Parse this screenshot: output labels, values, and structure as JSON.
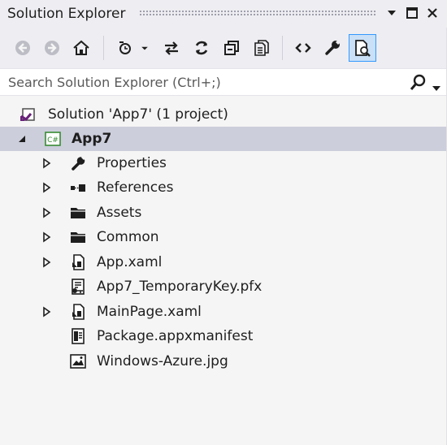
{
  "window": {
    "title": "Solution Explorer"
  },
  "toolbar": {
    "tools": [
      {
        "name": "back-icon"
      },
      {
        "name": "forward-icon"
      },
      {
        "name": "home-icon"
      },
      {
        "name": "pending-changes-filter-icon"
      },
      {
        "name": "sync-with-active-document-icon"
      },
      {
        "name": "refresh-icon"
      },
      {
        "name": "collapse-all-icon"
      },
      {
        "name": "show-all-files-icon"
      },
      {
        "name": "view-code-icon"
      },
      {
        "name": "properties-icon"
      },
      {
        "name": "preview-selected-items-icon"
      }
    ]
  },
  "search": {
    "placeholder": "Search Solution Explorer (Ctrl+;)"
  },
  "tree": {
    "solution": {
      "label": "Solution 'App7' (1 project)"
    },
    "project": {
      "label": "App7",
      "selected": true
    },
    "items": [
      {
        "label": "Properties",
        "icon": "wrench-icon",
        "expandable": true
      },
      {
        "label": "References",
        "icon": "references-icon",
        "expandable": true
      },
      {
        "label": "Assets",
        "icon": "folder-icon",
        "expandable": true
      },
      {
        "label": "Common",
        "icon": "folder-icon",
        "expandable": true
      },
      {
        "label": "App.xaml",
        "icon": "xaml-file-icon",
        "expandable": true
      },
      {
        "label": "App7_TemporaryKey.pfx",
        "icon": "certificate-file-icon",
        "expandable": false
      },
      {
        "label": "MainPage.xaml",
        "icon": "xaml-file-icon",
        "expandable": true
      },
      {
        "label": "Package.appxmanifest",
        "icon": "manifest-file-icon",
        "expandable": false
      },
      {
        "label": "Windows-Azure.jpg",
        "icon": "image-file-icon",
        "expandable": false
      }
    ]
  },
  "colors": {
    "accent": "#3399ff",
    "selection": "#cccedb",
    "background": "#f5f5f5",
    "csharp_green": "#388a34",
    "vs_purple": "#68217a"
  }
}
